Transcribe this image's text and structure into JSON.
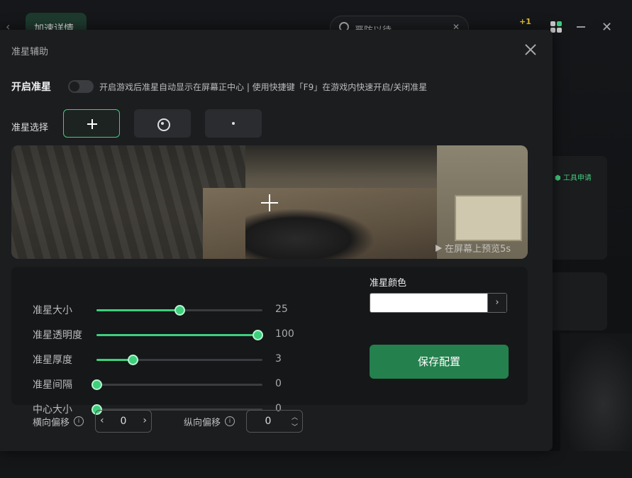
{
  "background": {
    "tab_label": "加速详情",
    "search_text": "严防以待",
    "badge_text": "+1",
    "tool_label": "工具申请"
  },
  "modal": {
    "title": "准星辅助",
    "enable_label": "开启准星",
    "enable_hint": "开启游戏后准星自动显示在屏幕正中心 | 使用快捷键「F9」在游戏内快速开启/关闭准星",
    "enabled": false,
    "select_label": "准星选择",
    "crosshair_options": [
      "cross-icon",
      "circle-dot-icon",
      "dot-icon"
    ],
    "selected_index": 0,
    "preview_button": "在屏幕上预览5s",
    "sliders": [
      {
        "label": "准星大小",
        "value": "25",
        "fraction": 0.5
      },
      {
        "label": "准星透明度",
        "value": "100",
        "fraction": 0.97
      },
      {
        "label": "准星厚度",
        "value": "3",
        "fraction": 0.22
      },
      {
        "label": "准星间隔",
        "value": "0",
        "fraction": 0.0
      },
      {
        "label": "中心大小",
        "value": "0",
        "fraction": 0.0
      }
    ],
    "color_label": "准星颜色",
    "color_value": "#FFFFFF",
    "save_label": "保存配置",
    "h_offset_label": "横向偏移",
    "h_offset_value": "0",
    "v_offset_label": "纵向偏移",
    "v_offset_value": "0"
  },
  "colors": {
    "accent": "#3ecf7d",
    "save_button": "#24804d"
  }
}
